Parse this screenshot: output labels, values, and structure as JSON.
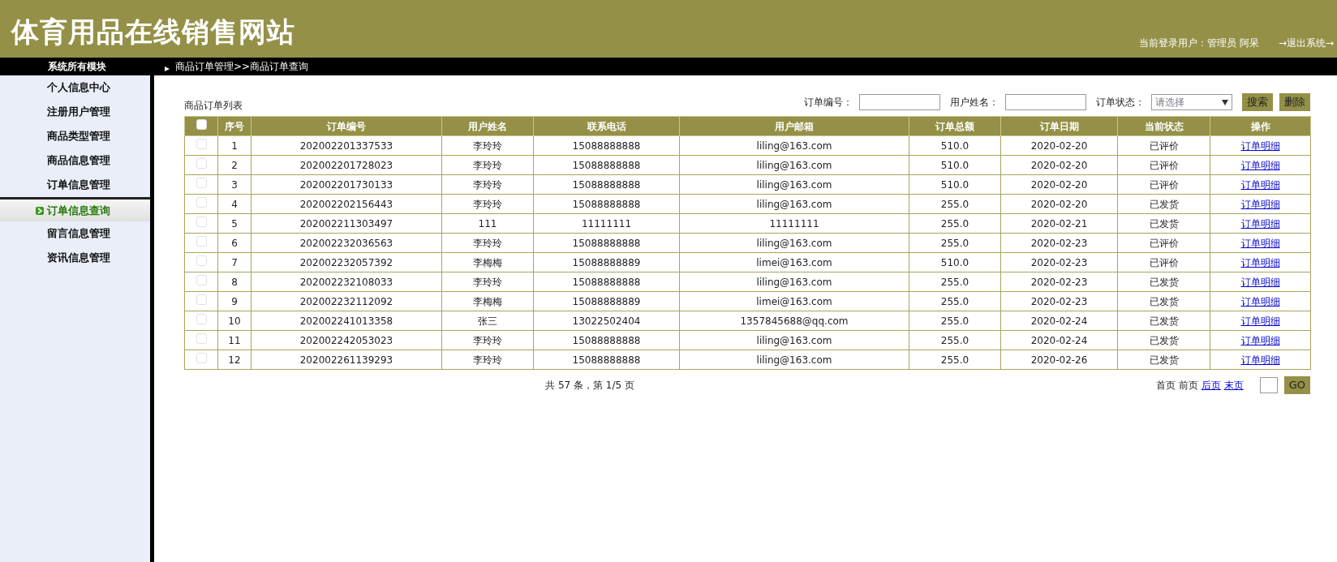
{
  "site_title": "体育用品在线销售网站",
  "user_info": "当前登录用户：管理员 阿呆",
  "logout": "→退出系统→",
  "sidebar": {
    "title": "系统所有模块",
    "items": [
      {
        "label": "个人信息中心",
        "selected": false
      },
      {
        "label": "注册用户管理",
        "selected": false
      },
      {
        "label": "商品类型管理",
        "selected": false
      },
      {
        "label": "商品信息管理",
        "selected": false
      },
      {
        "label": "订单信息管理",
        "selected": false
      },
      {
        "label": "订单信息查询",
        "selected": true
      },
      {
        "label": "留言信息管理",
        "selected": false
      },
      {
        "label": "资讯信息管理",
        "selected": false
      }
    ]
  },
  "breadcrumb": "商品订单管理>>商品订单查询",
  "list_title": "商品订单列表",
  "filters": [
    {
      "label": "订单编号：",
      "kind": "text"
    },
    {
      "label": "用户姓名：",
      "kind": "text"
    },
    {
      "label": "订单状态：",
      "kind": "select",
      "placeholder": "请选择"
    }
  ],
  "buttons": [
    "搜索",
    "删除"
  ],
  "table": {
    "select_all_checked": false,
    "columns": [
      "序号",
      "订单编号",
      "用户姓名",
      "联系电话",
      "用户邮箱",
      "订单总额",
      "订单日期",
      "当前状态",
      "操作"
    ],
    "rows": [
      {
        "checked": false,
        "cells": [
          "1",
          "202002201337533",
          "李玲玲",
          "15088888888",
          "liling@163.com",
          "510.0",
          "2020-02-20",
          "已评价"
        ],
        "action": "订单明细"
      },
      {
        "checked": false,
        "cells": [
          "2",
          "202002201728023",
          "李玲玲",
          "15088888888",
          "liling@163.com",
          "510.0",
          "2020-02-20",
          "已评价"
        ],
        "action": "订单明细"
      },
      {
        "checked": false,
        "cells": [
          "3",
          "202002201730133",
          "李玲玲",
          "15088888888",
          "liling@163.com",
          "510.0",
          "2020-02-20",
          "已评价"
        ],
        "action": "订单明细"
      },
      {
        "checked": false,
        "cells": [
          "4",
          "202002202156443",
          "李玲玲",
          "15088888888",
          "liling@163.com",
          "255.0",
          "2020-02-20",
          "已发货"
        ],
        "action": "订单明细"
      },
      {
        "checked": false,
        "cells": [
          "5",
          "202002211303497",
          "111",
          "11111111",
          "11111111",
          "255.0",
          "2020-02-21",
          "已发货"
        ],
        "action": "订单明细"
      },
      {
        "checked": false,
        "cells": [
          "6",
          "202002232036563",
          "李玲玲",
          "15088888888",
          "liling@163.com",
          "255.0",
          "2020-02-23",
          "已评价"
        ],
        "action": "订单明细"
      },
      {
        "checked": false,
        "cells": [
          "7",
          "202002232057392",
          "李梅梅",
          "15088888889",
          "limei@163.com",
          "510.0",
          "2020-02-23",
          "已评价"
        ],
        "action": "订单明细"
      },
      {
        "checked": false,
        "cells": [
          "8",
          "202002232108033",
          "李玲玲",
          "15088888888",
          "liling@163.com",
          "255.0",
          "2020-02-23",
          "已发货"
        ],
        "action": "订单明细"
      },
      {
        "checked": false,
        "cells": [
          "9",
          "202002232112092",
          "李梅梅",
          "15088888889",
          "limei@163.com",
          "255.0",
          "2020-02-23",
          "已发货"
        ],
        "action": "订单明细"
      },
      {
        "checked": false,
        "cells": [
          "10",
          "202002241013358",
          "张三",
          "13022502404",
          "1357845688@qq.com",
          "255.0",
          "2020-02-24",
          "已发货"
        ],
        "action": "订单明细"
      },
      {
        "checked": false,
        "cells": [
          "11",
          "202002242053023",
          "李玲玲",
          "15088888888",
          "liling@163.com",
          "255.0",
          "2020-02-24",
          "已发货"
        ],
        "action": "订单明细"
      },
      {
        "checked": false,
        "cells": [
          "12",
          "202002261139293",
          "李玲玲",
          "15088888888",
          "liling@163.com",
          "255.0",
          "2020-02-26",
          "已发货"
        ],
        "action": "订单明细"
      }
    ]
  },
  "pagination": {
    "summary": "共 57 条，第 1/5 页",
    "links": [
      {
        "label": "首页",
        "disabled": true
      },
      {
        "label": "前页",
        "disabled": true
      },
      {
        "label": "后页",
        "disabled": false
      },
      {
        "label": "末页",
        "disabled": false
      }
    ],
    "go": "GO"
  }
}
